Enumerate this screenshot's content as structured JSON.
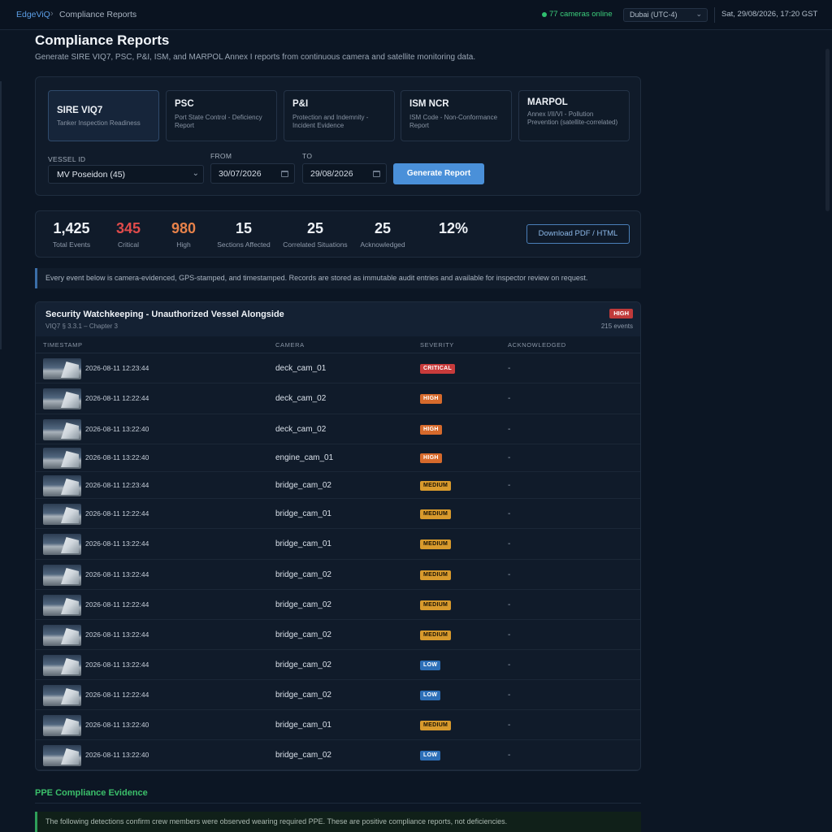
{
  "topbar": {
    "app_name": "EdgeViQ",
    "separator": "›",
    "page": "Compliance Reports",
    "cameras_online": "77 cameras online",
    "timezone": "Dubai (UTC-4)",
    "datetime": "Sat, 29/08/2026, 17:20 GST",
    "colors": {
      "online": "#3ccf7c",
      "accent": "#5c9ee6"
    }
  },
  "header": {
    "title": "Compliance Reports",
    "subtitle": "Generate SIRE VIQ7, PSC, P&I, ISM, and MARPOL Annex I reports from continuous camera and satellite monitoring data."
  },
  "report_types": [
    {
      "title": "SIRE VIQ7",
      "desc": "Tanker Inspection Readiness",
      "active": true
    },
    {
      "title": "PSC",
      "desc": "Port State Control - Deficiency Report",
      "active": false
    },
    {
      "title": "P&I",
      "desc": "Protection and Indemnity - Incident Evidence",
      "active": false
    },
    {
      "title": "ISM NCR",
      "desc": "ISM Code - Non-Conformance Report",
      "active": false
    },
    {
      "title": "MARPOL",
      "desc": "Annex I/II/VI - Pollution Prevention (satellite-correlated)",
      "active": false
    }
  ],
  "form": {
    "vessel_label": "VESSEL ID",
    "vessel_value": "MV Poseidon (45)",
    "from_label": "FROM",
    "from_value": "30/07/2026",
    "to_label": "TO",
    "to_value": "29/08/2026",
    "generate_label": "Generate Report"
  },
  "stats": [
    {
      "value": "1,425",
      "label": "Total Events",
      "tone": ""
    },
    {
      "value": "345",
      "label": "Critical",
      "tone": "critical"
    },
    {
      "value": "980",
      "label": "High",
      "tone": "high"
    },
    {
      "value": "15",
      "label": "Sections Affected",
      "tone": ""
    },
    {
      "value": "25",
      "label": "Correlated Situations",
      "tone": ""
    },
    {
      "value": "25",
      "label": "Acknowledged",
      "tone": ""
    },
    {
      "value": "12%",
      "label": "",
      "tone": ""
    }
  ],
  "download_label": "Download PDF / HTML",
  "notice": "Every event below is camera-evidenced, GPS-stamped, and timestamped. Records are stored as immutable audit entries and available for inspector review on request.",
  "section": {
    "title": "Security Watchkeeping - Unauthorized Vessel Alongside",
    "ref": "VIQ7 § 3.3.1 – Chapter 3",
    "badge": "HIGH",
    "count": "215 events",
    "columns": [
      "TIMESTAMP",
      "CAMERA",
      "SEVERITY",
      "ACKNOWLEDGED"
    ],
    "rows": [
      {
        "ts": "2026-08-11 12:23:44",
        "cam": "deck_cam_01",
        "sev": "CRITICAL",
        "ack": "-"
      },
      {
        "ts": "2026-08-11 12:22:44",
        "cam": "deck_cam_02",
        "sev": "HIGH",
        "ack": "-"
      },
      {
        "ts": "2026-08-11 13:22:40",
        "cam": "deck_cam_02",
        "sev": "HIGH",
        "ack": "-"
      },
      {
        "ts": "2026-08-11 13:22:40",
        "cam": "engine_cam_01",
        "sev": "HIGH",
        "ack": "-"
      },
      {
        "ts": "2026-08-11 12:23:44",
        "cam": "bridge_cam_02",
        "sev": "MEDIUM",
        "ack": "-"
      },
      {
        "ts": "2026-08-11 12:22:44",
        "cam": "bridge_cam_01",
        "sev": "MEDIUM",
        "ack": "-"
      },
      {
        "ts": "2026-08-11 13:22:44",
        "cam": "bridge_cam_01",
        "sev": "MEDIUM",
        "ack": "-"
      },
      {
        "ts": "2026-08-11 13:22:44",
        "cam": "bridge_cam_02",
        "sev": "MEDIUM",
        "ack": "-"
      },
      {
        "ts": "2026-08-11 12:22:44",
        "cam": "bridge_cam_02",
        "sev": "MEDIUM",
        "ack": "-"
      },
      {
        "ts": "2026-08-11 13:22:44",
        "cam": "bridge_cam_02",
        "sev": "MEDIUM",
        "ack": "-"
      },
      {
        "ts": "2026-08-11 13:22:44",
        "cam": "bridge_cam_02",
        "sev": "LOW",
        "ack": "-"
      },
      {
        "ts": "2026-08-11 12:22:44",
        "cam": "bridge_cam_02",
        "sev": "LOW",
        "ack": "-"
      },
      {
        "ts": "2026-08-11 13:22:40",
        "cam": "bridge_cam_01",
        "sev": "MEDIUM",
        "ack": "-"
      },
      {
        "ts": "2026-08-11 13:22:40",
        "cam": "bridge_cam_02",
        "sev": "LOW",
        "ack": "-"
      }
    ]
  },
  "ppe": {
    "title": "PPE Compliance Evidence",
    "notice": "The following detections confirm crew members were observed wearing required PPE. These are positive compliance reports, not deficiencies."
  }
}
